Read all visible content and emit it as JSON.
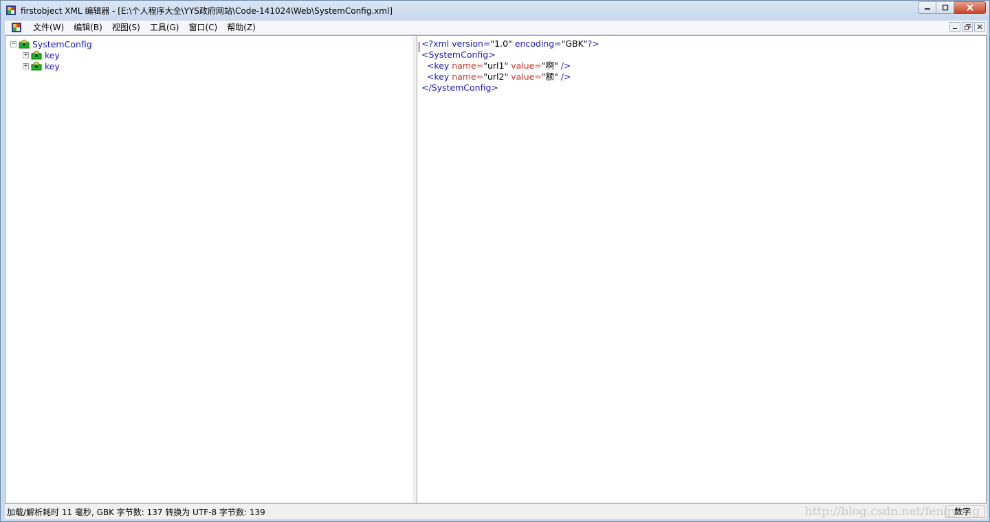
{
  "window": {
    "title": "firstobject XML 编辑器 - [E:\\个人程序大全\\YYS政府网站\\Code-141024\\Web\\SystemConfig.xml]"
  },
  "menu": {
    "items": [
      {
        "label": "文件(W)"
      },
      {
        "label": "编辑(B)"
      },
      {
        "label": "视图(S)"
      },
      {
        "label": "工具(G)"
      },
      {
        "label": "窗口(C)"
      },
      {
        "label": "帮助(Z)"
      }
    ]
  },
  "tree": {
    "root": {
      "label": "SystemConfig",
      "expander": "−"
    },
    "children": [
      {
        "label": "key",
        "expander": "+"
      },
      {
        "label": "key",
        "expander": "+"
      }
    ]
  },
  "source": {
    "line1": {
      "pi_open": "<?xml ",
      "attr1": "version=",
      "val1": "\"1.0\"",
      "sp": " ",
      "attr2": "encoding=",
      "val2": "\"GBK\"",
      "pi_close": "?>"
    },
    "line2": {
      "tag": "<SystemConfig>"
    },
    "line3": {
      "indent": "  ",
      "open": "<key ",
      "a1": "name=",
      "v1": "\"url1\"",
      "s1": " ",
      "a2": "value=",
      "v2": "\"啊\"",
      "close": " />"
    },
    "line4": {
      "indent": "  ",
      "open": "<key ",
      "a1": "name=",
      "v1": "\"url2\"",
      "s1": " ",
      "a2": "value=",
      "v2": "\"额\"",
      "close": " />"
    },
    "line5": {
      "tag": "</SystemConfig>"
    }
  },
  "status": {
    "text": "加载/解析耗时 11 毫秒, GBK 字节数: 137 转换为 UTF-8 字节数: 139",
    "panel": "数字",
    "watermark": "http://blog.csdn.net/fengyang"
  },
  "colors": {
    "tag": "#1a1ab8",
    "attr": "#c0392b",
    "titlebar": "#c7d7ec",
    "close_button": "#c6452b"
  }
}
